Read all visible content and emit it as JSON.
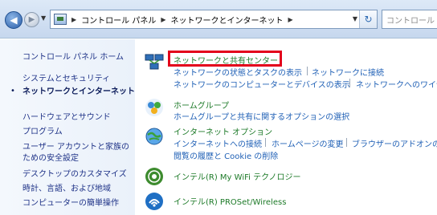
{
  "address_bar": {
    "back_icon": "back-arrow-icon",
    "forward_icon": "forward-arrow-icon",
    "breadcrumbs": [
      "コントロール パネル",
      "ネットワークとインターネット"
    ],
    "search_placeholder": "コントロール"
  },
  "sidebar": {
    "items": [
      {
        "label": "コントロール パネル ホーム"
      },
      {
        "label": "システムとセキュリティ"
      },
      {
        "label": "ネットワークとインターネット"
      },
      {
        "label": "ハードウェアとサウンド"
      },
      {
        "label": "プログラム"
      },
      {
        "label": "ユーザー アカウントと家族の"
      },
      {
        "label": "ための安全設定"
      },
      {
        "label": "デスクトップのカスタマイズ"
      },
      {
        "label": "時計、言語、および地域"
      },
      {
        "label": "コンピューターの簡単操作"
      }
    ]
  },
  "categories": [
    {
      "title": "ネットワークと共有センター",
      "links": [
        "ネットワークの状態とタスクの表示",
        "ネットワークに接続",
        "ネットワークのコンピューターとデバイスの表示",
        "ネットワークへのワイヤ"
      ]
    },
    {
      "title": "ホームグループ",
      "links": [
        "ホームグループと共有に関するオプションの選択"
      ]
    },
    {
      "title": "インターネット オプション",
      "links": [
        "インターネットへの接続",
        "ホームページの変更",
        "ブラウザーのアドオンの",
        "閲覧の履歴と Cookie の削除"
      ]
    },
    {
      "title": "インテル(R) My WiFi テクノロジー",
      "links": []
    },
    {
      "title": "インテル(R) PROSet/Wireless",
      "links": []
    }
  ],
  "colors": {
    "highlight": "#e3001b",
    "category_title": "#1d7a28",
    "link": "#2161b6"
  }
}
